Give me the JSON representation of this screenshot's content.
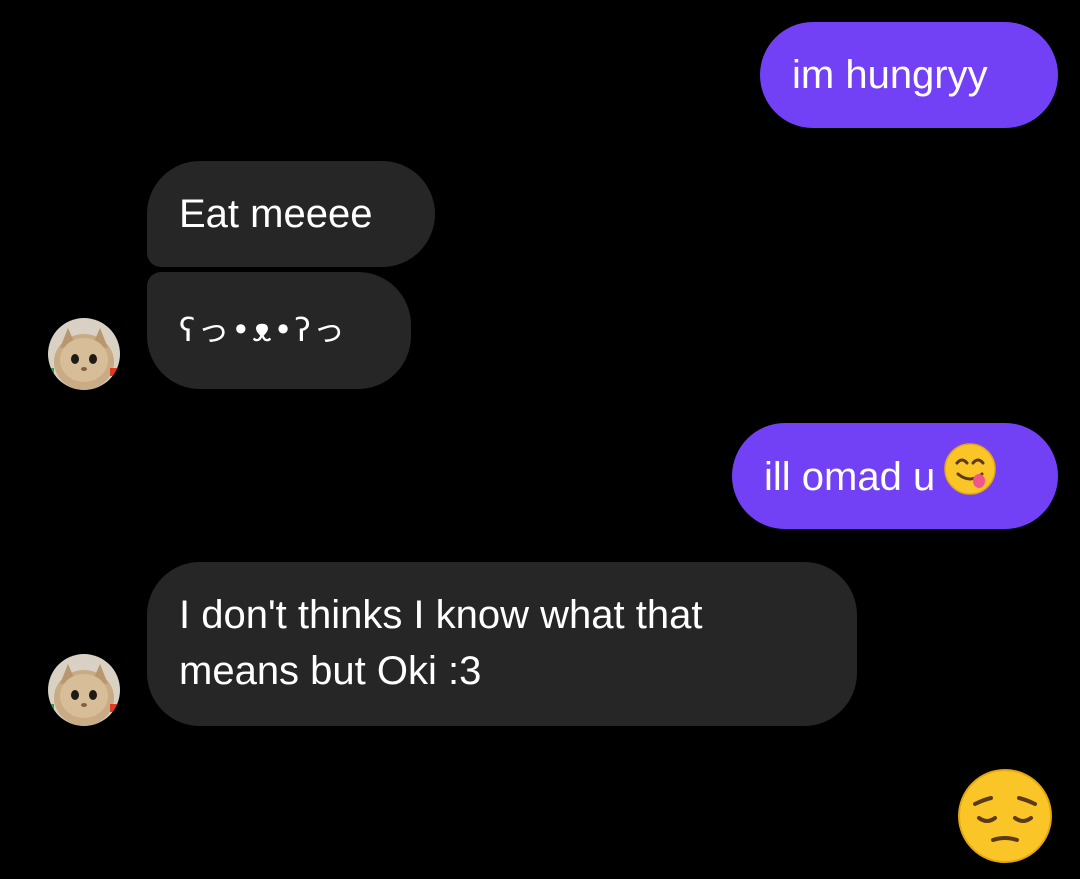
{
  "conversation": {
    "messages": [
      {
        "from": "me",
        "text": "im hungryy"
      },
      {
        "from": "them",
        "text": "Eat meeee"
      },
      {
        "from": "them",
        "text": "ʕっ•ᴥ•ʔっ"
      },
      {
        "from": "me",
        "text": "ill omad u",
        "emoji": "face-savoring-food-emoji"
      },
      {
        "from": "them",
        "lines": [
          "I don't thinks I know what that",
          "means but Oki :3"
        ]
      },
      {
        "from": "me",
        "emoji": "pensive-face-emoji"
      }
    ]
  },
  "colors": {
    "background": "#000000",
    "sent_bubble": "#7341f5",
    "received_bubble": "#262626",
    "text": "#ffffff"
  }
}
